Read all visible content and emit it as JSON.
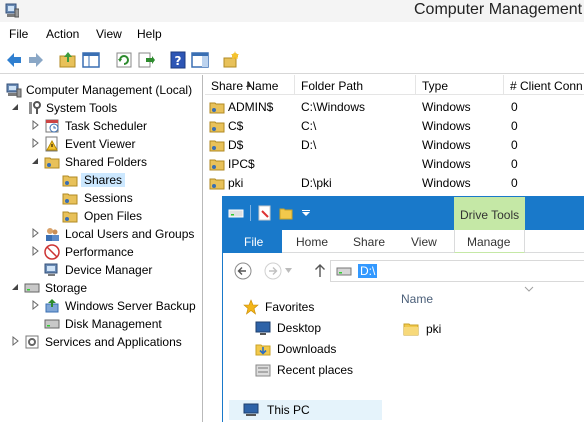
{
  "window": {
    "title": "Computer Management"
  },
  "menubar": {
    "items": [
      "File",
      "Action",
      "View",
      "Help"
    ]
  },
  "toolbar": {
    "buttons": [
      "back-icon",
      "forward-icon",
      "up-folder-icon",
      "show-hide-tree-icon",
      "refresh-icon",
      "export-list-icon",
      "help-icon",
      "action-pane-icon",
      "new-share-icon"
    ]
  },
  "tree": {
    "root": "Computer Management (Local)",
    "system_tools": "System Tools",
    "task_scheduler": "Task Scheduler",
    "event_viewer": "Event Viewer",
    "shared_folders": "Shared Folders",
    "shares": "Shares",
    "sessions": "Sessions",
    "open_files": "Open Files",
    "local_users": "Local Users and Groups",
    "performance": "Performance",
    "device_manager": "Device Manager",
    "storage": "Storage",
    "wsb": "Windows Server Backup",
    "disk_management": "Disk Management",
    "services_apps": "Services and Applications"
  },
  "shares_list": {
    "columns": [
      "Share Name",
      "Folder Path",
      "Type",
      "# Client Conn"
    ],
    "rows": [
      {
        "name": "ADMIN$",
        "path": "C:\\Windows",
        "type": "Windows",
        "clients": "0"
      },
      {
        "name": "C$",
        "path": "C:\\",
        "type": "Windows",
        "clients": "0"
      },
      {
        "name": "D$",
        "path": "D:\\",
        "type": "Windows",
        "clients": "0"
      },
      {
        "name": "IPC$",
        "path": "",
        "type": "Windows",
        "clients": "0"
      },
      {
        "name": "pki",
        "path": "D:\\pki",
        "type": "Windows",
        "clients": "0"
      }
    ]
  },
  "explorer": {
    "context_tab_group": "Drive Tools",
    "tabs": {
      "file": "File",
      "home": "Home",
      "share": "Share",
      "view": "View",
      "manage": "Manage"
    },
    "address": "D:\\",
    "nav": {
      "favorites": "Favorites",
      "desktop": "Desktop",
      "downloads": "Downloads",
      "recent": "Recent places",
      "this_pc": "This PC"
    },
    "files_header": "Name",
    "files": [
      "pki"
    ]
  },
  "colors": {
    "explorer_accent": "#1979ca",
    "drive_tools": "#c5e8a6",
    "selection": "#cce8ff",
    "address_highlight": "#3399ff"
  }
}
